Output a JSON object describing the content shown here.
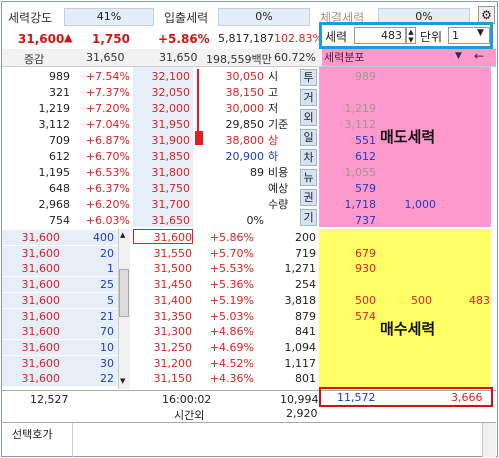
{
  "top": {
    "strength_label": "세력강도",
    "strength_val": "41%",
    "inout_label": "입출세력",
    "inout_val": "0%",
    "trade_label": "체결세력",
    "trade_val": "0%"
  },
  "price": {
    "current": "31,600",
    "arrow": "▲",
    "change": "1,750",
    "pct": "+5.86%",
    "volume": "5,817,187",
    "vol_pct": "102.83%"
  },
  "control": {
    "force_label": "세력",
    "force_val": "483",
    "unit_label": "단위",
    "unit_val": "1"
  },
  "header": {
    "diff": "증감",
    "ask_price": "31,650",
    "bid_price": "31,650",
    "amount": "198,559백만",
    "ratio": "60.72%",
    "dist": "세력분포"
  },
  "sell_rows": [
    {
      "qty": "989",
      "pct": "+7.54%",
      "price": "32,100",
      "f1": "989"
    },
    {
      "qty": "321",
      "pct": "+7.37%",
      "price": "32,050",
      "f1": ""
    },
    {
      "qty": "1,219",
      "pct": "+7.20%",
      "price": "32,000",
      "f1": "1,219"
    },
    {
      "qty": "3,112",
      "pct": "+7.04%",
      "price": "31,950",
      "f1": "3,112"
    },
    {
      "qty": "709",
      "pct": "+6.87%",
      "price": "31,900",
      "f1": "551"
    },
    {
      "qty": "612",
      "pct": "+6.70%",
      "price": "31,850",
      "f1": "612"
    },
    {
      "qty": "1,195",
      "pct": "+6.53%",
      "price": "31,800",
      "f1": "1,055"
    },
    {
      "qty": "648",
      "pct": "+6.37%",
      "price": "31,750",
      "f1": "579"
    },
    {
      "qty": "2,968",
      "pct": "+6.20%",
      "price": "31,700",
      "f1": "1,718",
      "f2": "1,000"
    },
    {
      "qty": "754",
      "pct": "+6.03%",
      "price": "31,650",
      "f1": "737"
    }
  ],
  "info": [
    {
      "val": "30,050",
      "label": "시"
    },
    {
      "val": "38,150",
      "label": "고"
    },
    {
      "val": "30,000",
      "label": "저"
    },
    {
      "val": "29,850",
      "label": "기준"
    },
    {
      "val": "38,800",
      "label": "상"
    },
    {
      "val": "20,900",
      "label": "하"
    },
    {
      "val": "89",
      "label": "비용"
    },
    {
      "val": "",
      "label": "예상"
    },
    {
      "val": "",
      "label": "수량"
    },
    {
      "val": "0%",
      "label": ""
    }
  ],
  "tabs": [
    "투",
    "거",
    "외",
    "일",
    "차",
    "뉴",
    "권",
    "기"
  ],
  "sell_label": "매도세력",
  "buy_rows": [
    {
      "hist": "31,600",
      "hqty": "400",
      "price": "31,600",
      "pct": "+5.86%",
      "qty": "200",
      "f1": "",
      "f2": "",
      "f3": ""
    },
    {
      "hist": "31,600",
      "hqty": "20",
      "price": "31,550",
      "pct": "+5.70%",
      "qty": "719",
      "f1": "679",
      "f2": "",
      "f3": ""
    },
    {
      "hist": "31,600",
      "hqty": "1",
      "price": "31,500",
      "pct": "+5.53%",
      "qty": "1,271",
      "f1": "930",
      "f2": "",
      "f3": ""
    },
    {
      "hist": "31,600",
      "hqty": "25",
      "price": "31,450",
      "pct": "+5.36%",
      "qty": "254",
      "f1": "",
      "f2": "",
      "f3": ""
    },
    {
      "hist": "31,600",
      "hqty": "5",
      "price": "31,400",
      "pct": "+5.19%",
      "qty": "3,818",
      "f1": "500",
      "f2": "500",
      "f3": "483"
    },
    {
      "hist": "31,600",
      "hqty": "21",
      "price": "31,350",
      "pct": "+5.03%",
      "qty": "879",
      "f1": "574",
      "f2": "",
      "f3": ""
    },
    {
      "hist": "31,600",
      "hqty": "70",
      "price": "31,300",
      "pct": "+4.86%",
      "qty": "841",
      "f1": "",
      "f2": "",
      "f3": ""
    },
    {
      "hist": "31,600",
      "hqty": "10",
      "price": "31,250",
      "pct": "+4.69%",
      "qty": "1,094",
      "f1": "",
      "f2": "",
      "f3": ""
    },
    {
      "hist": "31,600",
      "hqty": "30",
      "price": "31,200",
      "pct": "+4.52%",
      "qty": "1,117",
      "f1": "",
      "f2": "",
      "f3": ""
    },
    {
      "hist": "31,600",
      "hqty": "22",
      "price": "31,150",
      "pct": "+4.36%",
      "qty": "801",
      "f1": "",
      "f2": "",
      "f3": ""
    }
  ],
  "buy_label": "매수세력",
  "bottom": {
    "sell_total": "12,527",
    "time": "16:00:02",
    "after": "시간외",
    "buy_total": "10,994",
    "after_qty": "2,920",
    "force_sum1": "11,572",
    "force_sum2": "3,666"
  },
  "select_label": "선택호가"
}
